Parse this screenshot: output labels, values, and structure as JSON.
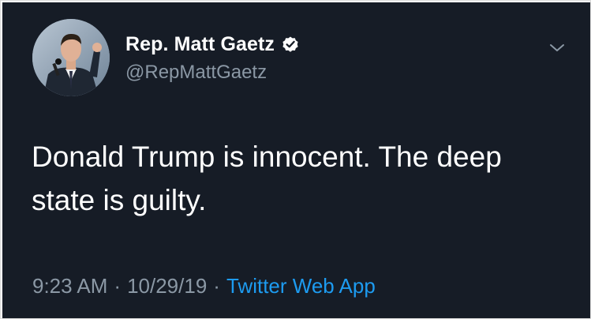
{
  "tweet": {
    "display_name": "Rep. Matt Gaetz",
    "handle": "@RepMattGaetz",
    "verified": true,
    "text": "Donald Trump is innocent. The deep state is guilty.",
    "time": "9:23 AM",
    "date": "10/29/19",
    "separator": "·",
    "source": "Twitter Web App"
  },
  "icons": {
    "avatar": "profile-photo",
    "verified": "verified-badge-icon",
    "caret": "chevron-down-icon"
  },
  "colors": {
    "background": "#161c26",
    "text": "#ffffff",
    "secondary": "#8b98a5",
    "link": "#1d9bf0"
  }
}
